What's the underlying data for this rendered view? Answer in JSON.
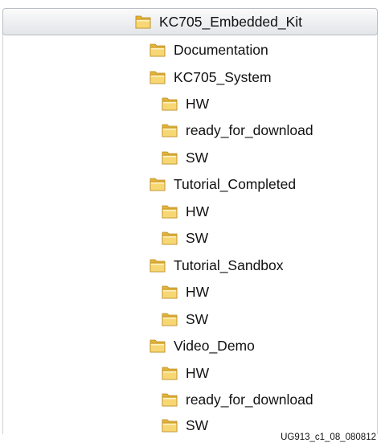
{
  "colors": {
    "folder_back": "#e4b43a",
    "folder_front": "#f7d774",
    "folder_edge": "#b98a1e",
    "folder_highlight": "#fff3c4"
  },
  "tree": {
    "root": {
      "label": "KC705_Embedded_Kit",
      "icon": "folder-icon"
    },
    "items": [
      {
        "label": "Documentation",
        "icon": "folder-icon"
      },
      {
        "label": "KC705_System",
        "icon": "folder-icon"
      },
      {
        "label": "HW",
        "icon": "folder-icon"
      },
      {
        "label": "ready_for_download",
        "icon": "folder-icon"
      },
      {
        "label": "SW",
        "icon": "folder-icon"
      },
      {
        "label": "Tutorial_Completed",
        "icon": "folder-icon"
      },
      {
        "label": "HW",
        "icon": "folder-icon"
      },
      {
        "label": "SW",
        "icon": "folder-icon"
      },
      {
        "label": "Tutorial_Sandbox",
        "icon": "folder-icon"
      },
      {
        "label": "HW",
        "icon": "folder-icon"
      },
      {
        "label": "SW",
        "icon": "folder-icon"
      },
      {
        "label": "Video_Demo",
        "icon": "folder-icon"
      },
      {
        "label": "HW",
        "icon": "folder-icon"
      },
      {
        "label": "ready_for_download",
        "icon": "folder-icon"
      },
      {
        "label": "SW",
        "icon": "folder-icon"
      }
    ]
  },
  "footer": {
    "figure_id": "UG913_c1_08_080812"
  }
}
